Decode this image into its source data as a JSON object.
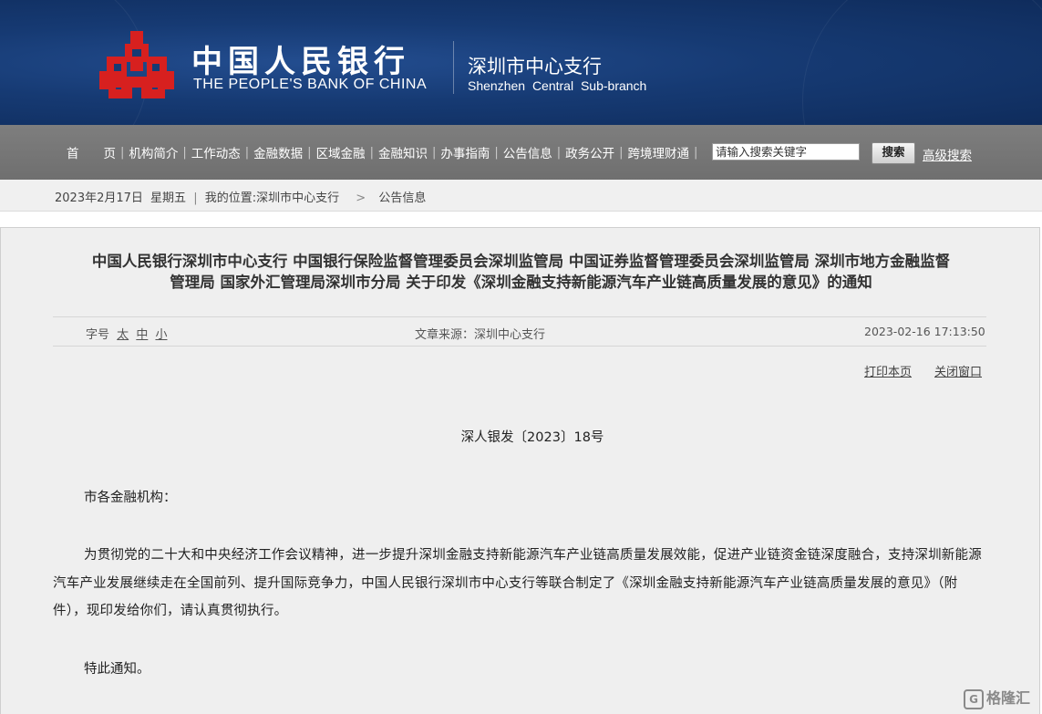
{
  "header": {
    "brand_cn": "中国人民银行",
    "brand_en": "THE PEOPLE'S BANK OF CHINA",
    "branch_cn": "深圳市中心支行",
    "branch_en": "Shenzhen  Central  Sub-branch",
    "logo_icon": "pboc-logo-icon",
    "colors": {
      "banner": "#163a73",
      "logo": "#d7201f"
    }
  },
  "nav": {
    "items": [
      {
        "label": "首　　页"
      },
      {
        "label": "机构简介"
      },
      {
        "label": "工作动态"
      },
      {
        "label": "金融数据"
      },
      {
        "label": "区域金融"
      },
      {
        "label": "金融知识"
      },
      {
        "label": "办事指南"
      },
      {
        "label": "公告信息"
      },
      {
        "label": "政务公开"
      },
      {
        "label": "跨境理财通"
      }
    ],
    "search_placeholder": "请输入搜索关键字",
    "search_button": "搜索",
    "advanced_search": "高级搜索"
  },
  "breadcrumb": {
    "date": "2023年2月17日",
    "weekday": "星期五",
    "sep": "|",
    "location_label": "我的位置:",
    "path_1": "深圳市中心支行",
    "arrow": ">",
    "path_2": "公告信息"
  },
  "article": {
    "title_line1": "中国人民银行深圳市中心支行 中国银行保险监督管理委员会深圳监管局 中国证券监督管理委员会深圳监管局 深圳市地方金融监督",
    "title_line2": "管理局 国家外汇管理局深圳市分局 关于印发《深圳金融支持新能源汽车产业链高质量发展的意见》的通知",
    "font_size_label": "字号",
    "font_size_large": "太",
    "font_size_medium": "中",
    "font_size_small": "小",
    "source": "文章来源：深圳中心支行",
    "published": "2023-02-16  17:13:50",
    "print_label": "打印本页",
    "close_label": "关闭窗口",
    "doc_number": "深人银发〔2023〕18号",
    "salutation": "市各金融机构：",
    "body": "为贯彻党的二十大和中央经济工作会议精神，进一步提升深圳金融支持新能源汽车产业链高质量发展效能，促进产业链资金链深度融合，支持深圳新能源汽车产业发展继续走在全国前列、提升国际竞争力，中国人民银行深圳市中心支行等联合制定了《深圳金融支持新能源汽车产业链高质量发展的意见》（附件），现印发给你们，请认真贯彻执行。",
    "closing": "特此通知。"
  },
  "watermark": {
    "icon": "gelonghui-logo-icon",
    "glyph": "G",
    "text": "格隆汇"
  }
}
